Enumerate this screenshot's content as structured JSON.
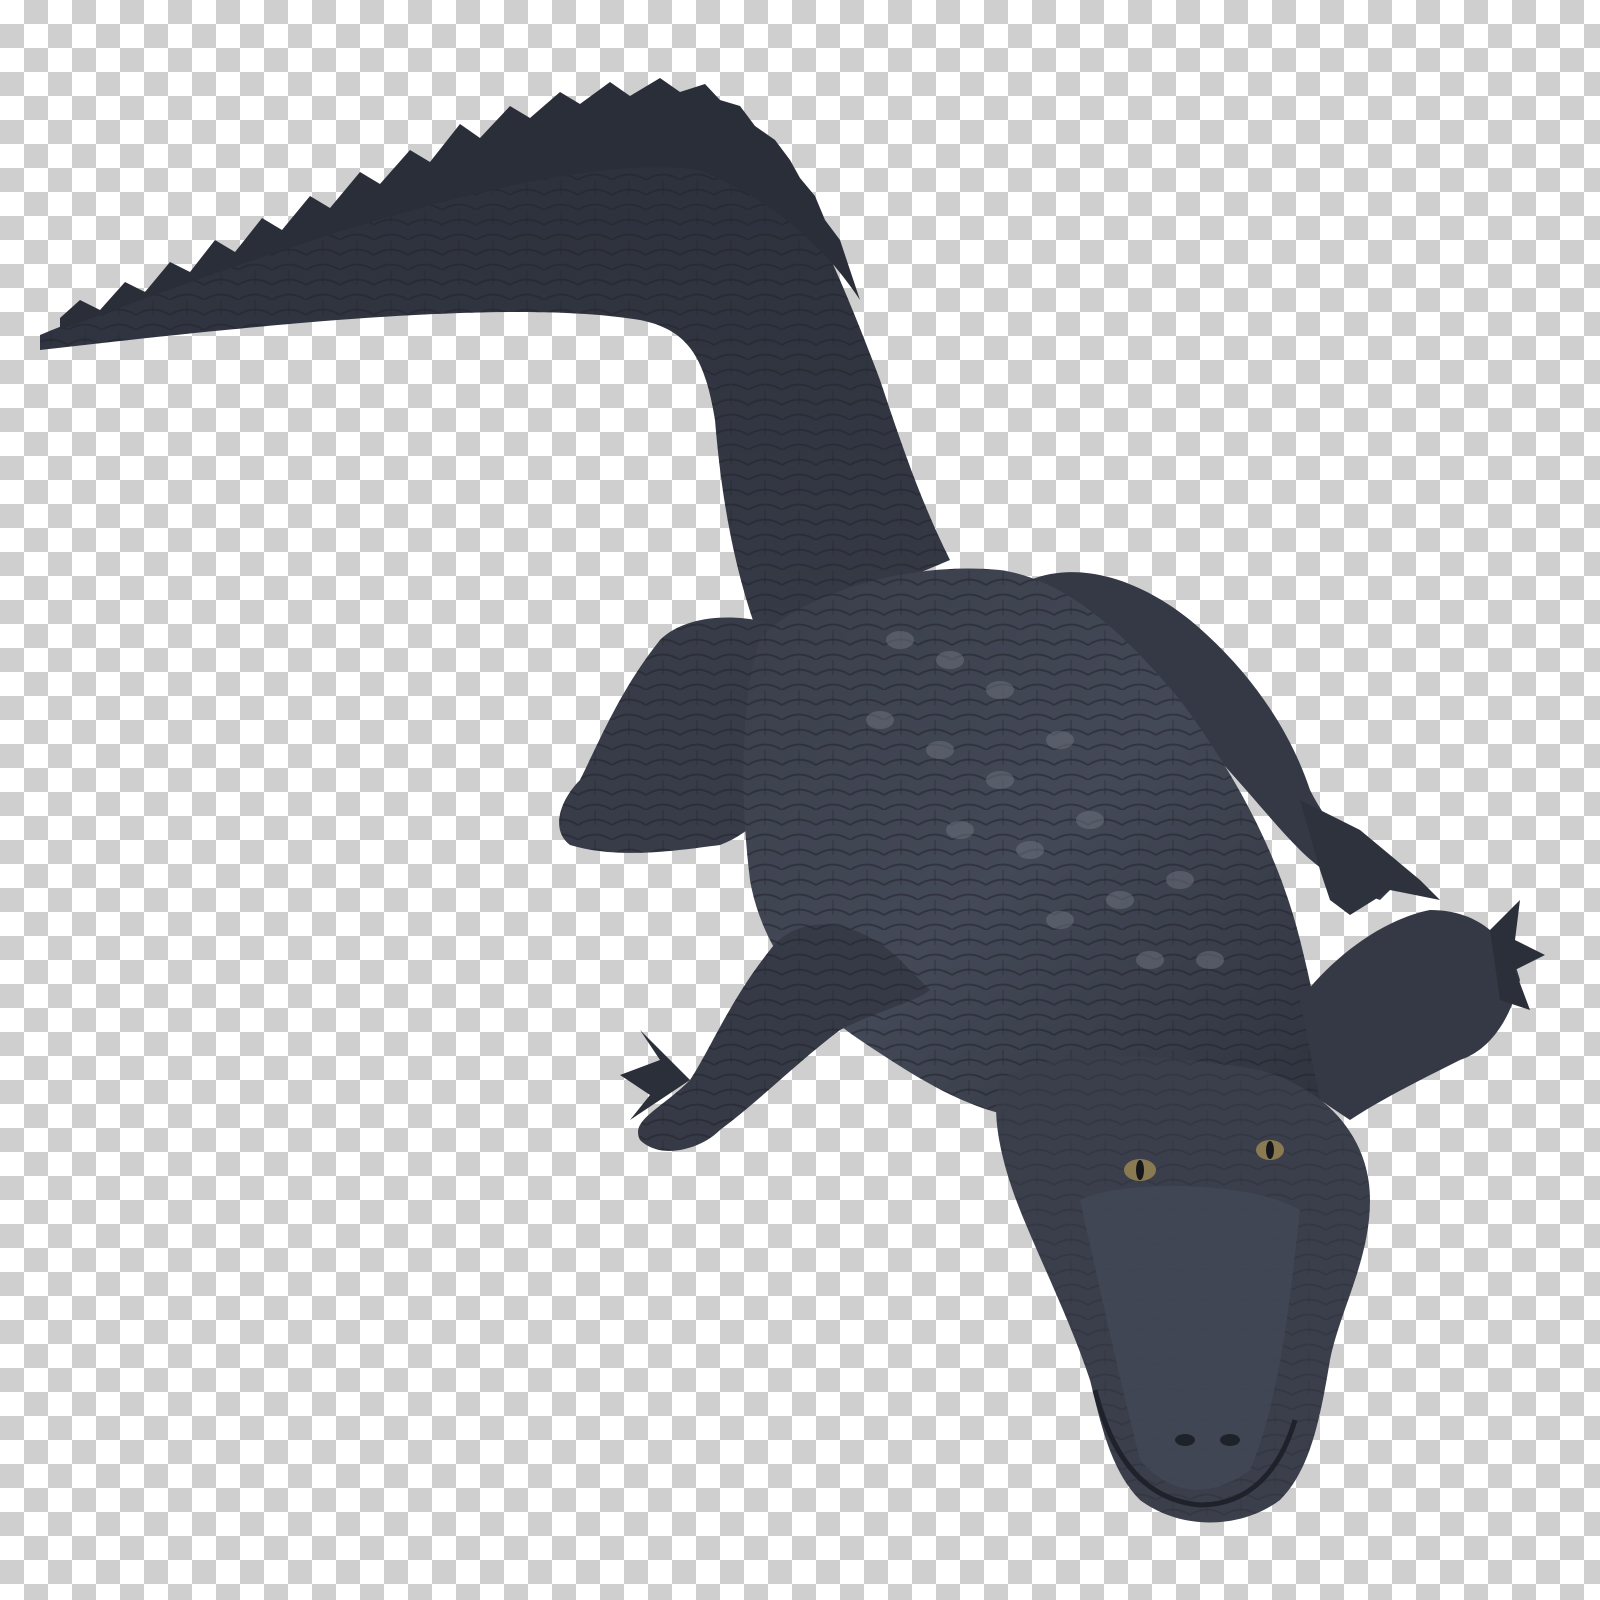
{
  "image": {
    "subject": "alligator-icon",
    "background": "transparency-checkerboard",
    "colors": {
      "checker_light": "#ffffff",
      "checker_dark": "#cfcfcf",
      "skin_dark": "#2b2f3a",
      "skin_mid": "#3d4250",
      "skin_light": "#5a5f6c",
      "scute_highlight": "#6b707c",
      "eye": "#8a7a52"
    }
  }
}
